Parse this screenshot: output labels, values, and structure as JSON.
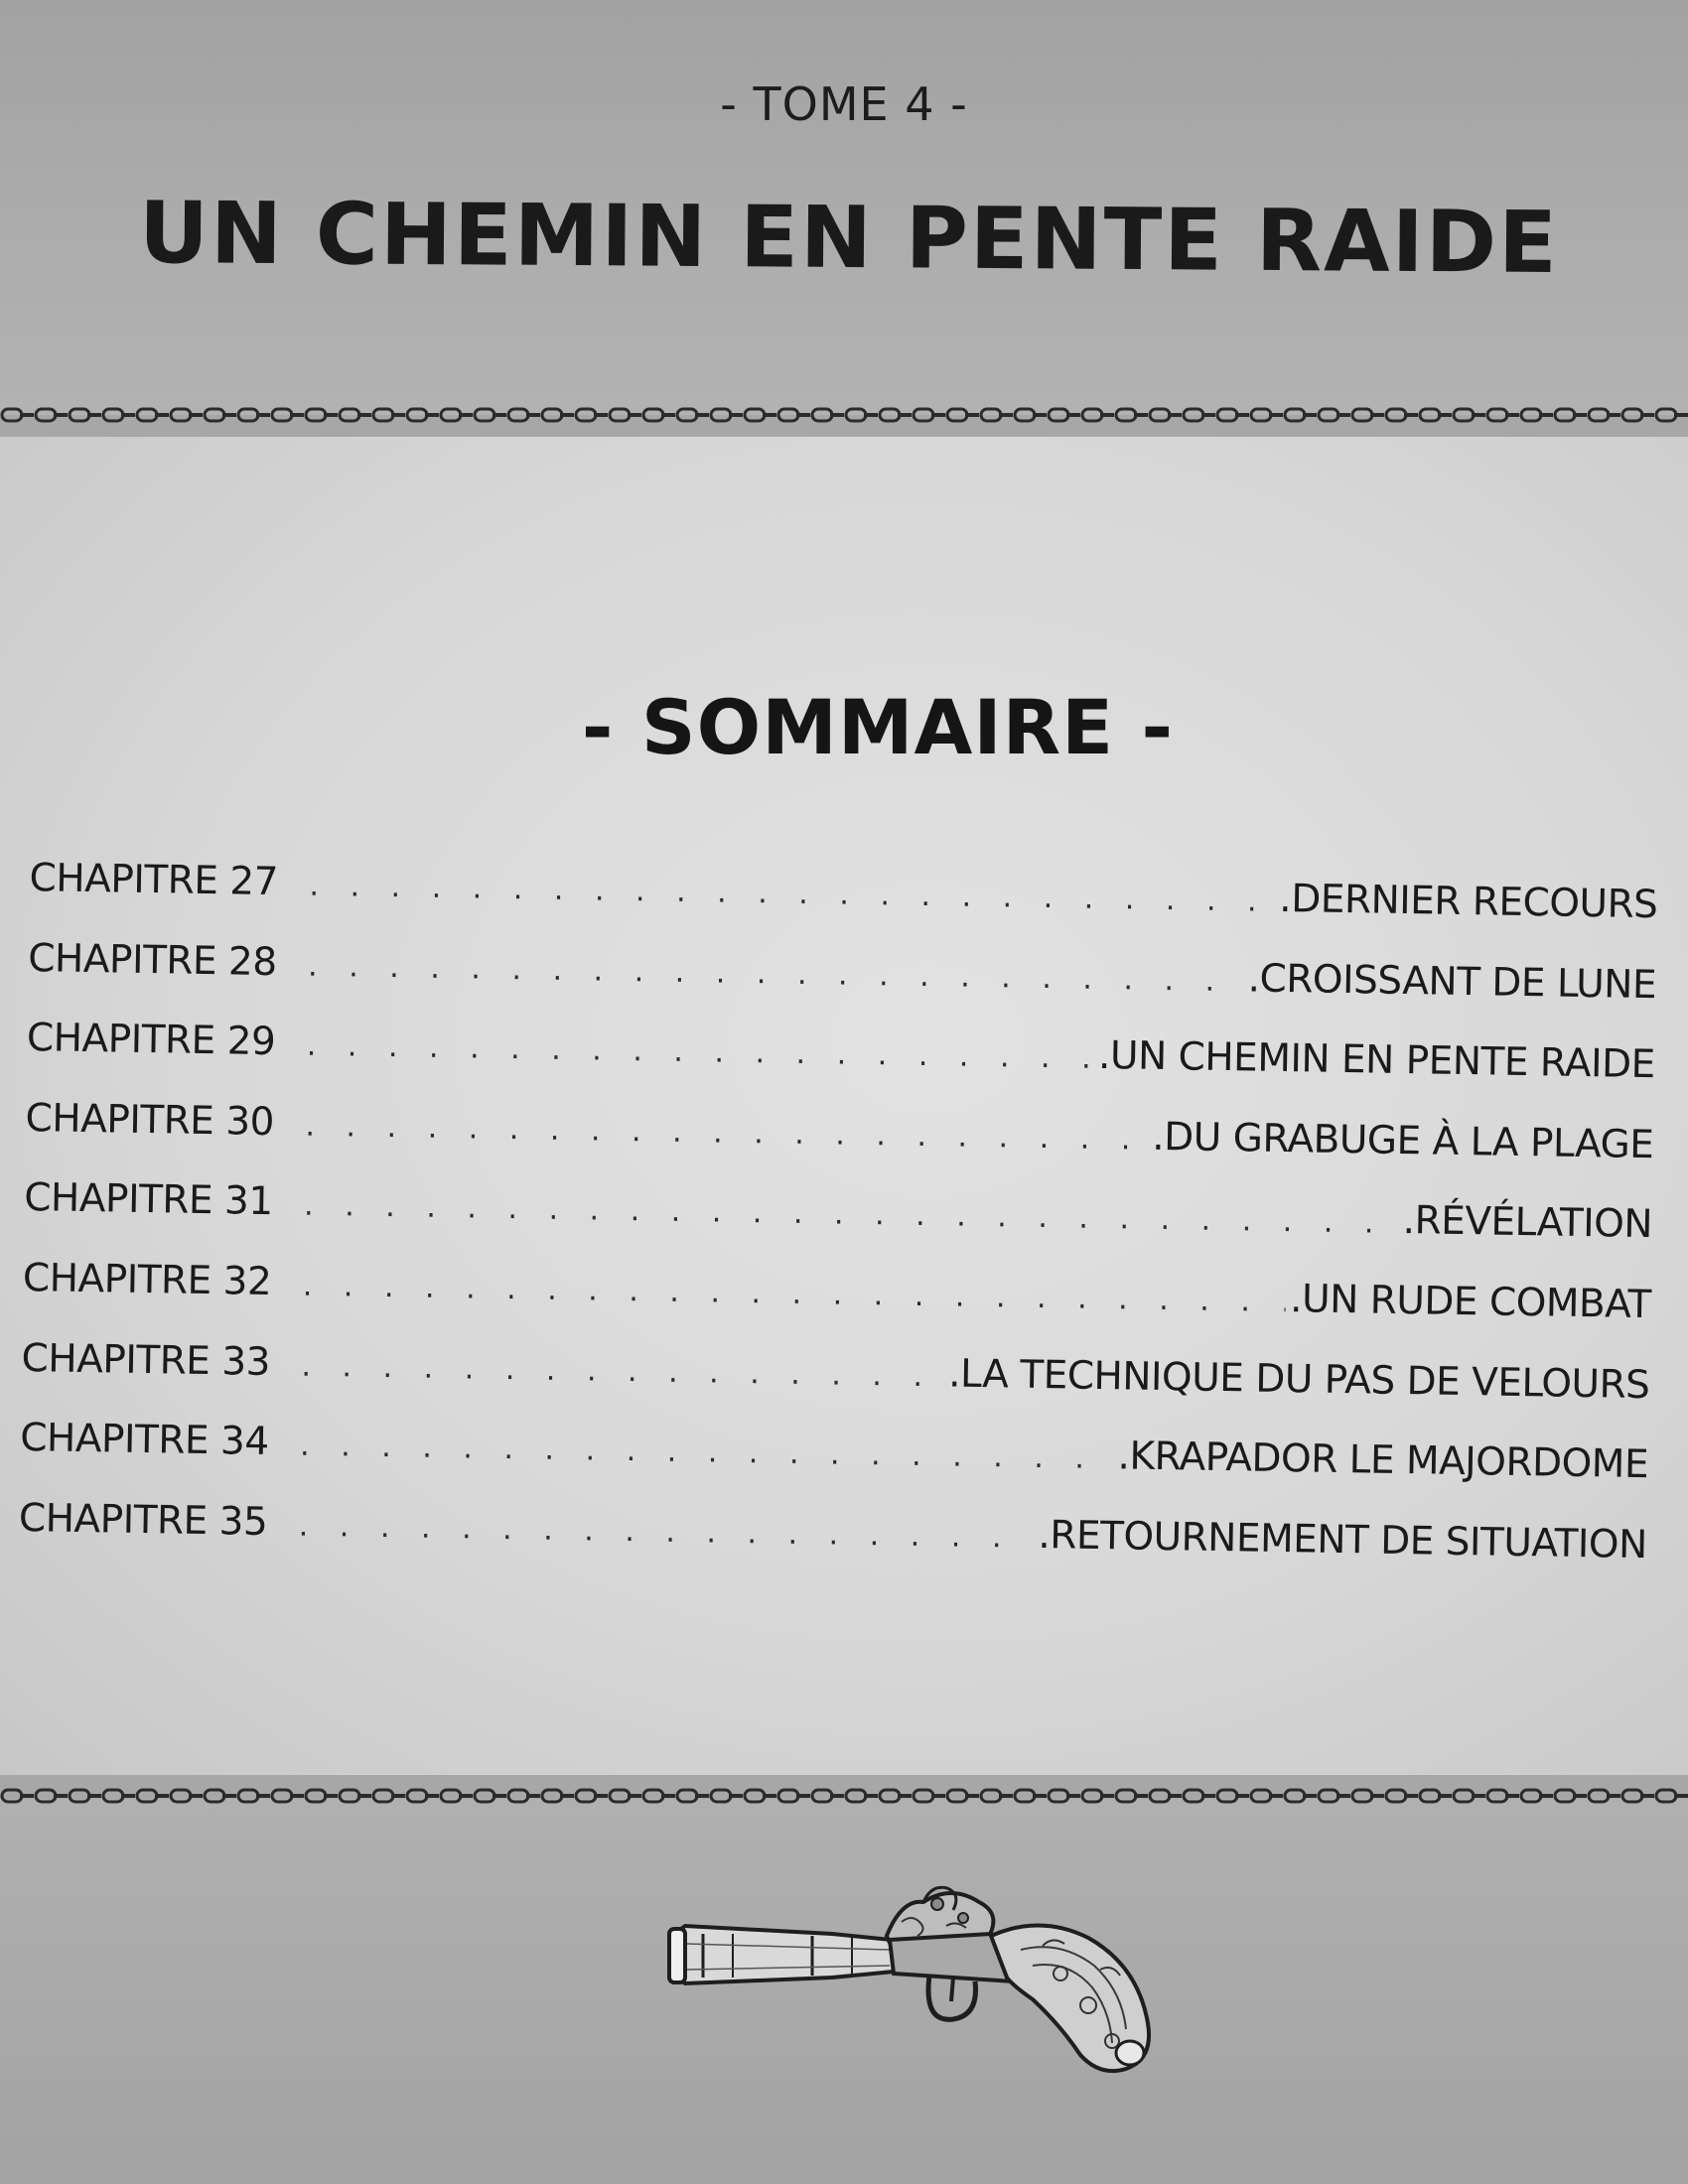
{
  "header": {
    "tome_label": "- TOME 4 -",
    "book_title": "UN CHEMIN EN PENTE RAIDE"
  },
  "summary": {
    "heading": "- SOMMAIRE -",
    "chapters": [
      {
        "number_label": "CHAPITRE  27",
        "title": ".DERNIER RECOURS"
      },
      {
        "number_label": "CHAPITRE  28",
        "title": ".CROISSANT DE LUNE"
      },
      {
        "number_label": "CHAPITRE 29",
        "title": ".UN CHEMIN EN PENTE RAIDE"
      },
      {
        "number_label": "CHAPITRE 30",
        "title": ".DU GRABUGE À LA PLAGE"
      },
      {
        "number_label": "CHAPITRE 31",
        "title": ".RÉVÉLATION"
      },
      {
        "number_label": "CHAPITRE 32",
        "title": ".UN RUDE COMBAT"
      },
      {
        "number_label": "CHAPITRE 33",
        "title": ".LA TECHNIQUE DU PAS DE VELOURS"
      },
      {
        "number_label": "CHAPITRE 34",
        "title": ".KRAPADOR LE MAJORDOME"
      },
      {
        "number_label": "CHAPITRE 35",
        "title": ".RETOURNEMENT DE SITUATION"
      }
    ]
  },
  "decorations": {
    "divider_icon": "chain-divider-icon",
    "bottom_icon": "flintlock-pistol-icon"
  }
}
